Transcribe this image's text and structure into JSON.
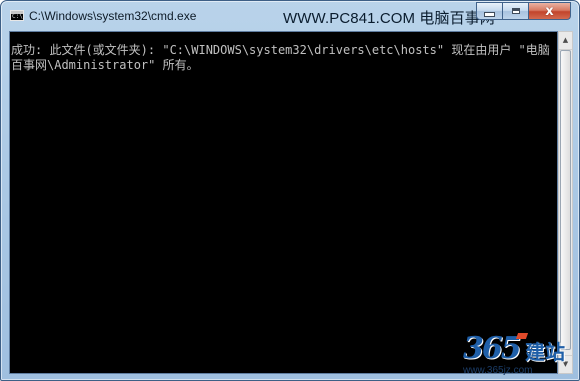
{
  "window": {
    "title": "C:\\Windows\\system32\\cmd.exe",
    "watermark_text": "WWW.PC841.COM 电脑百事网",
    "icon": "console-icon",
    "icon_text": "C:\\"
  },
  "controls": {
    "minimize_icon": "minimize-icon",
    "maximize_icon": "maximize-icon",
    "close_icon": "close-icon",
    "close_glyph": "x"
  },
  "console": {
    "lines": [
      "成功: 此文件(或文件夹): \"C:\\WINDOWS\\system32\\drivers\\etc\\hosts\" 现在由用户 \"电脑百事网\\Administrator\" 所有。"
    ],
    "background": "#000000",
    "foreground": "#c0c0c0"
  },
  "scrollbar": {
    "up_glyph": "▲",
    "down_glyph": "▼"
  },
  "logo": {
    "mark": "365",
    "name": "建站",
    "url": "www.365jz.com"
  },
  "colors": {
    "frame": "#a9c7e4",
    "close_button": "#c2442b",
    "logo_blue": "#1f5fa8",
    "logo_accent": "#e04a2a"
  }
}
